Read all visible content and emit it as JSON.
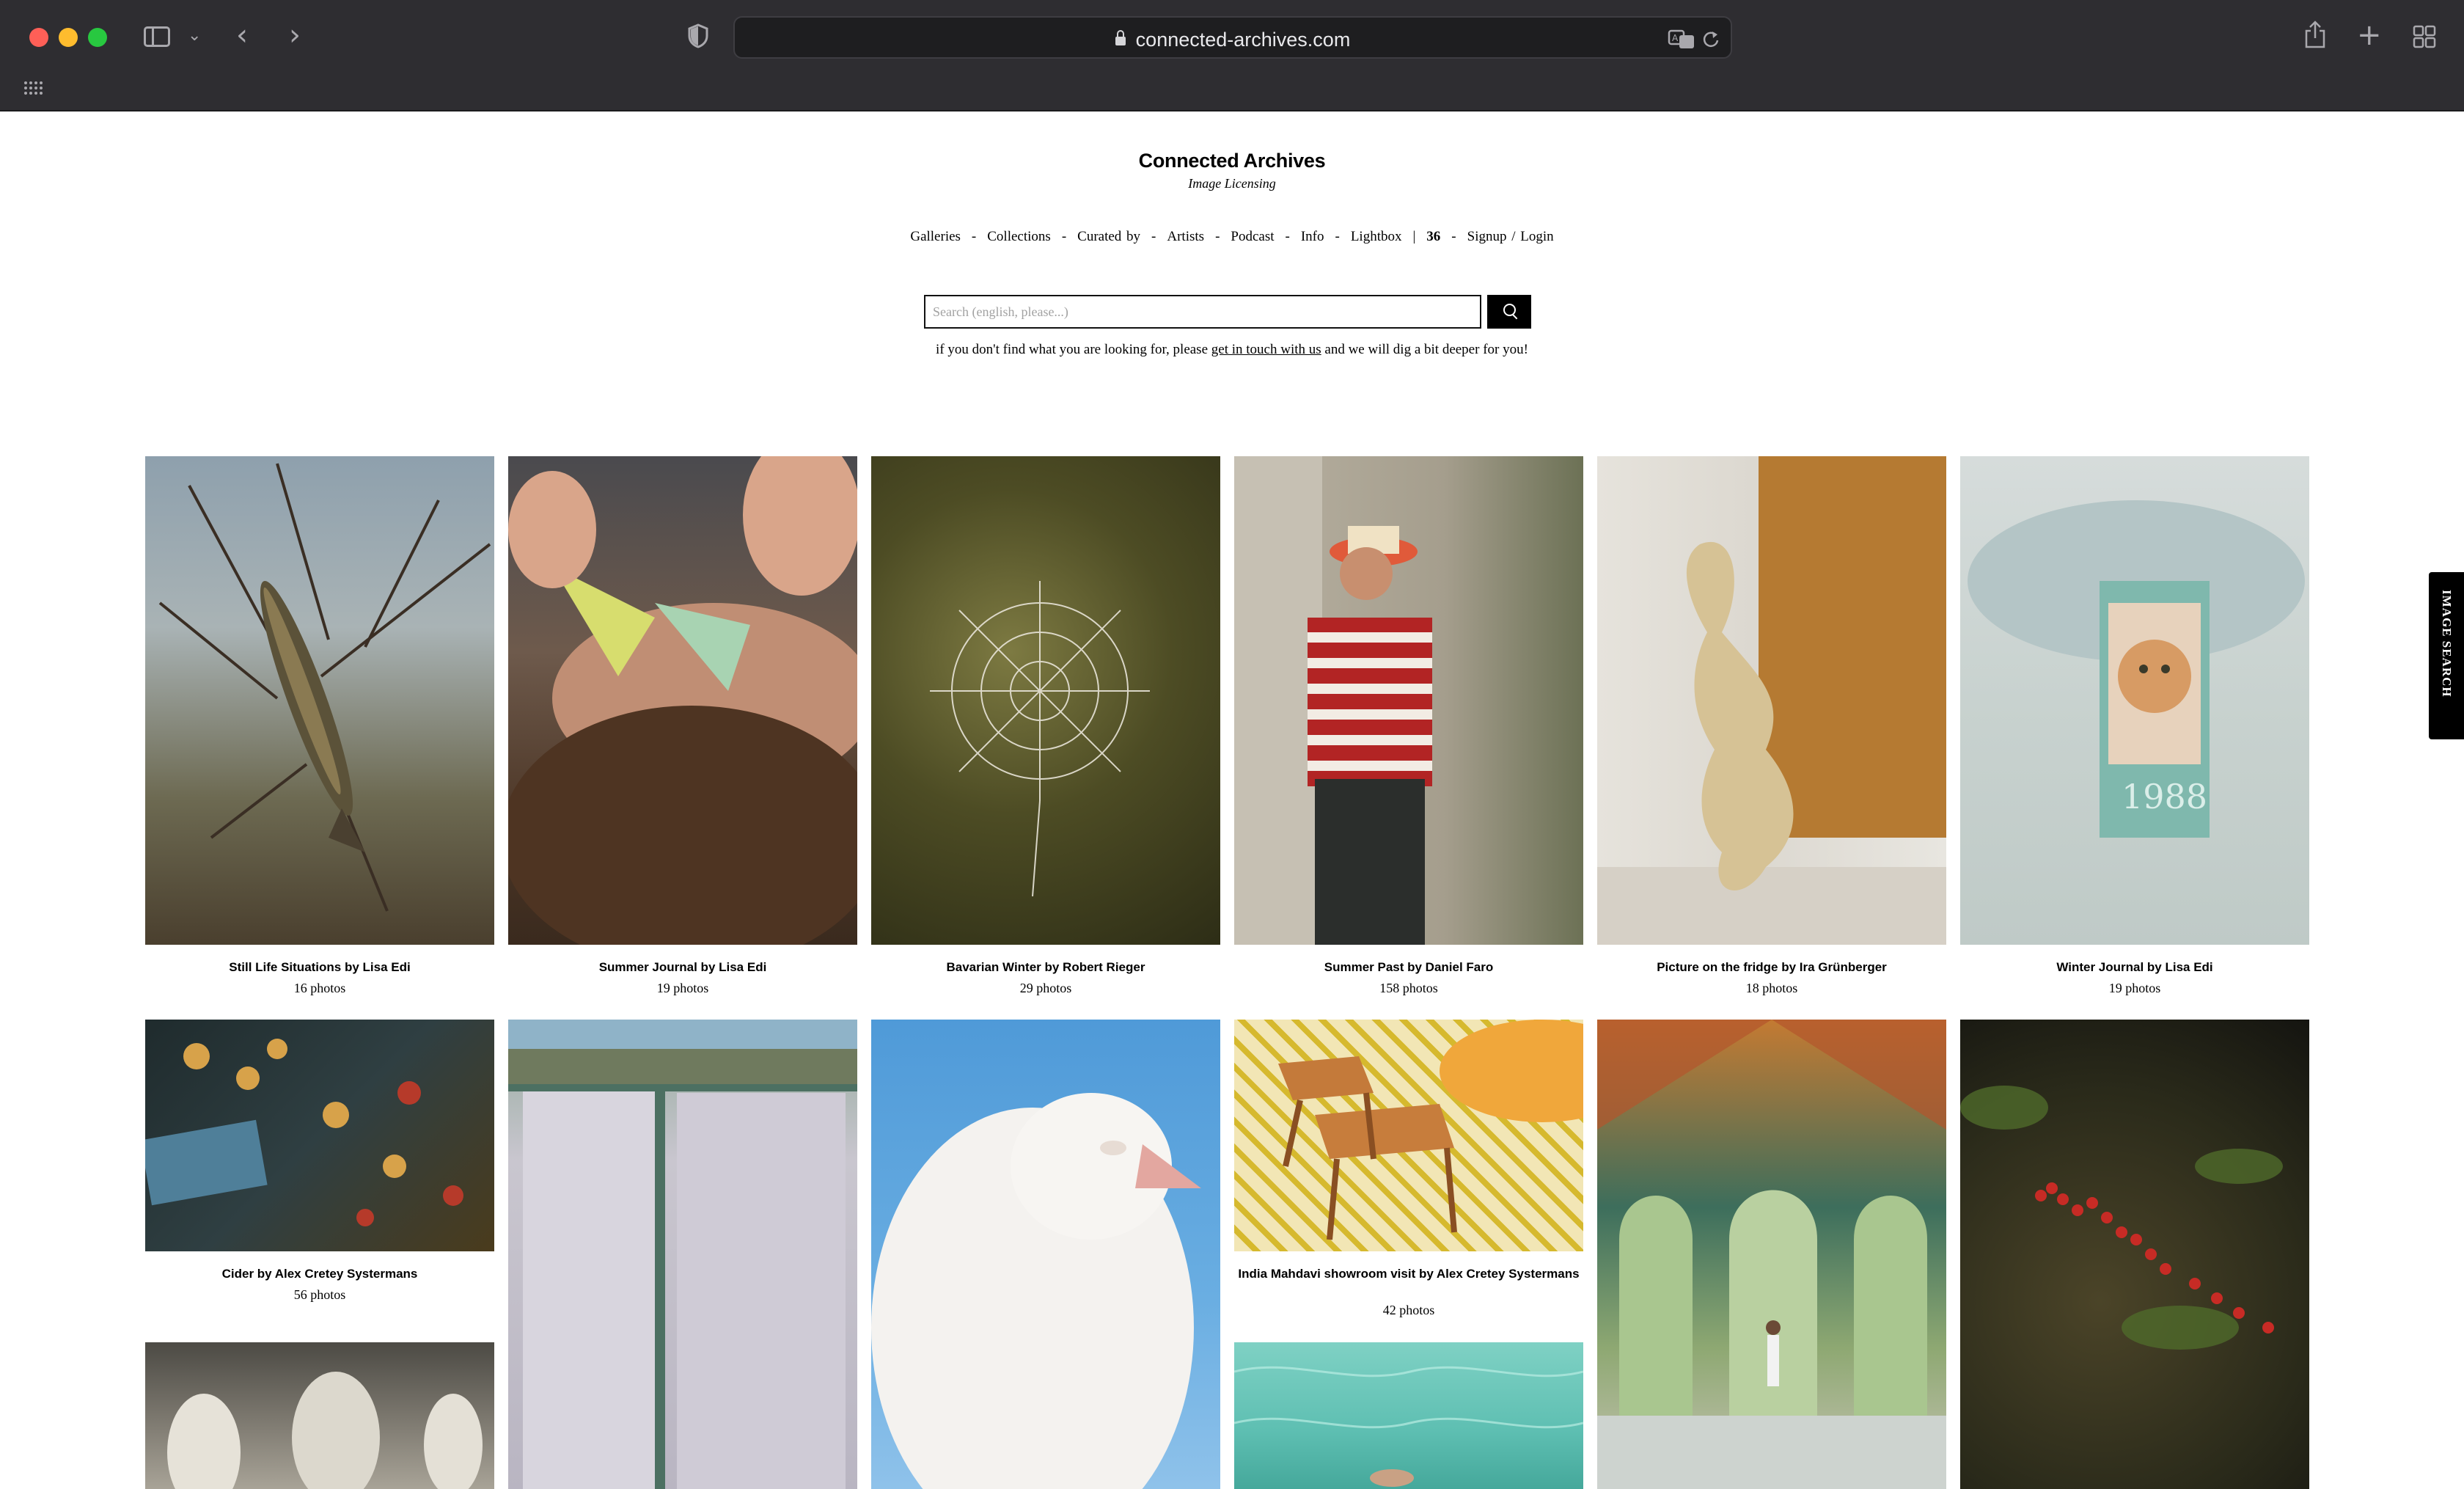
{
  "browser": {
    "url": "connected-archives.com"
  },
  "site": {
    "title": "Connected Archives",
    "subtitle": "Image Licensing"
  },
  "nav": {
    "galleries": "Galleries",
    "collections": "Collections",
    "curated_by": "Curated by",
    "artists": "Artists",
    "podcast": "Podcast",
    "info": "Info",
    "lightbox": "Lightbox",
    "lightbox_count": "36",
    "signup_login": "Signup / Login",
    "separator": "-",
    "pipe": "|"
  },
  "search": {
    "placeholder": "Search (english, please...)",
    "notice_before": "if you don't find what you are looking for, please ",
    "notice_link": "get in touch with us",
    "notice_after": " and we will dig a bit deeper for you!"
  },
  "side_tab": {
    "label": "IMAGE SEARCH"
  },
  "galleries": [
    {
      "title": "Still Life Situations by Lisa Edi",
      "count": "16 photos"
    },
    {
      "title": "Summer Journal by Lisa Edi",
      "count": "19 photos"
    },
    {
      "title": "Bavarian Winter by Robert Rieger",
      "count": "29 photos"
    },
    {
      "title": "Summer Past by Daniel Faro",
      "count": "158 photos"
    },
    {
      "title": "Picture on the fridge by Ira Grünberger",
      "count": "18 photos"
    },
    {
      "title": "Winter Journal by Lisa Edi",
      "count": "19 photos"
    },
    {
      "title": "Cider by Alex Cretey Systermans",
      "count": "56 photos"
    },
    {
      "title": "India Mahdavi showroom visit by Alex Cretey Systermans",
      "count": "42 photos"
    }
  ],
  "photo_art": {
    "calendar_year": "1988"
  },
  "colors": {
    "chrome_bg": "#2e2d31",
    "address_bg": "#1e1e20",
    "search_button": "#000000",
    "side_tab": "#000000"
  }
}
